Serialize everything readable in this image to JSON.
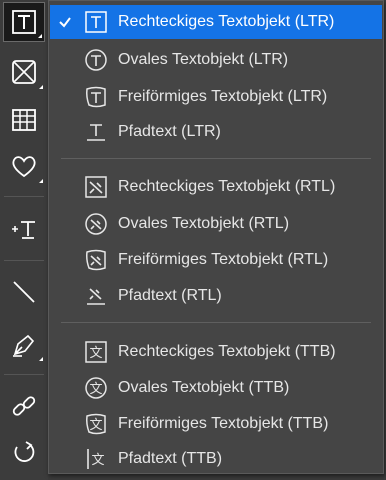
{
  "toolbar": {
    "tools": [
      {
        "icon": "text-tool-icon",
        "active": true,
        "has_flyout": true
      },
      {
        "icon": "frame-x-icon",
        "has_flyout": true
      },
      {
        "icon": "table-icon"
      },
      {
        "icon": "heart-shape-icon",
        "has_flyout": true
      },
      {
        "icon": "add-text-icon"
      },
      {
        "icon": "line-icon"
      },
      {
        "icon": "pen-icon",
        "has_flyout": true
      },
      {
        "icon": "link-icon"
      },
      {
        "icon": "rotate-icon"
      }
    ]
  },
  "menu": {
    "groups": [
      {
        "items": [
          {
            "label": "Rechteckiges Textobjekt (LTR)",
            "icon": "rect-text-ltr-icon",
            "selected": true,
            "checked": true
          },
          {
            "label": "Ovales Textobjekt (LTR)",
            "icon": "oval-text-ltr-icon"
          },
          {
            "label": "Freiförmiges Textobjekt (LTR)",
            "icon": "freeform-text-ltr-icon"
          },
          {
            "label": "Pfadtext (LTR)",
            "icon": "path-text-ltr-icon"
          }
        ]
      },
      {
        "items": [
          {
            "label": "Rechteckiges Textobjekt (RTL)",
            "icon": "rect-text-rtl-icon"
          },
          {
            "label": "Ovales Textobjekt (RTL)",
            "icon": "oval-text-rtl-icon"
          },
          {
            "label": "Freiförmiges Textobjekt (RTL)",
            "icon": "freeform-text-rtl-icon"
          },
          {
            "label": "Pfadtext (RTL)",
            "icon": "path-text-rtl-icon"
          }
        ]
      },
      {
        "items": [
          {
            "label": "Rechteckiges Textobjekt (TTB)",
            "icon": "rect-text-ttb-icon"
          },
          {
            "label": "Ovales Textobjekt (TTB)",
            "icon": "oval-text-ttb-icon"
          },
          {
            "label": "Freiförmiges Textobjekt (TTB)",
            "icon": "freeform-text-ttb-icon"
          },
          {
            "label": "Pfadtext (TTB)",
            "icon": "path-text-ttb-icon"
          }
        ]
      }
    ],
    "colors": {
      "selected_bg": "#1473e6",
      "menu_bg": "#454545",
      "text": "#e6e6e6"
    }
  }
}
